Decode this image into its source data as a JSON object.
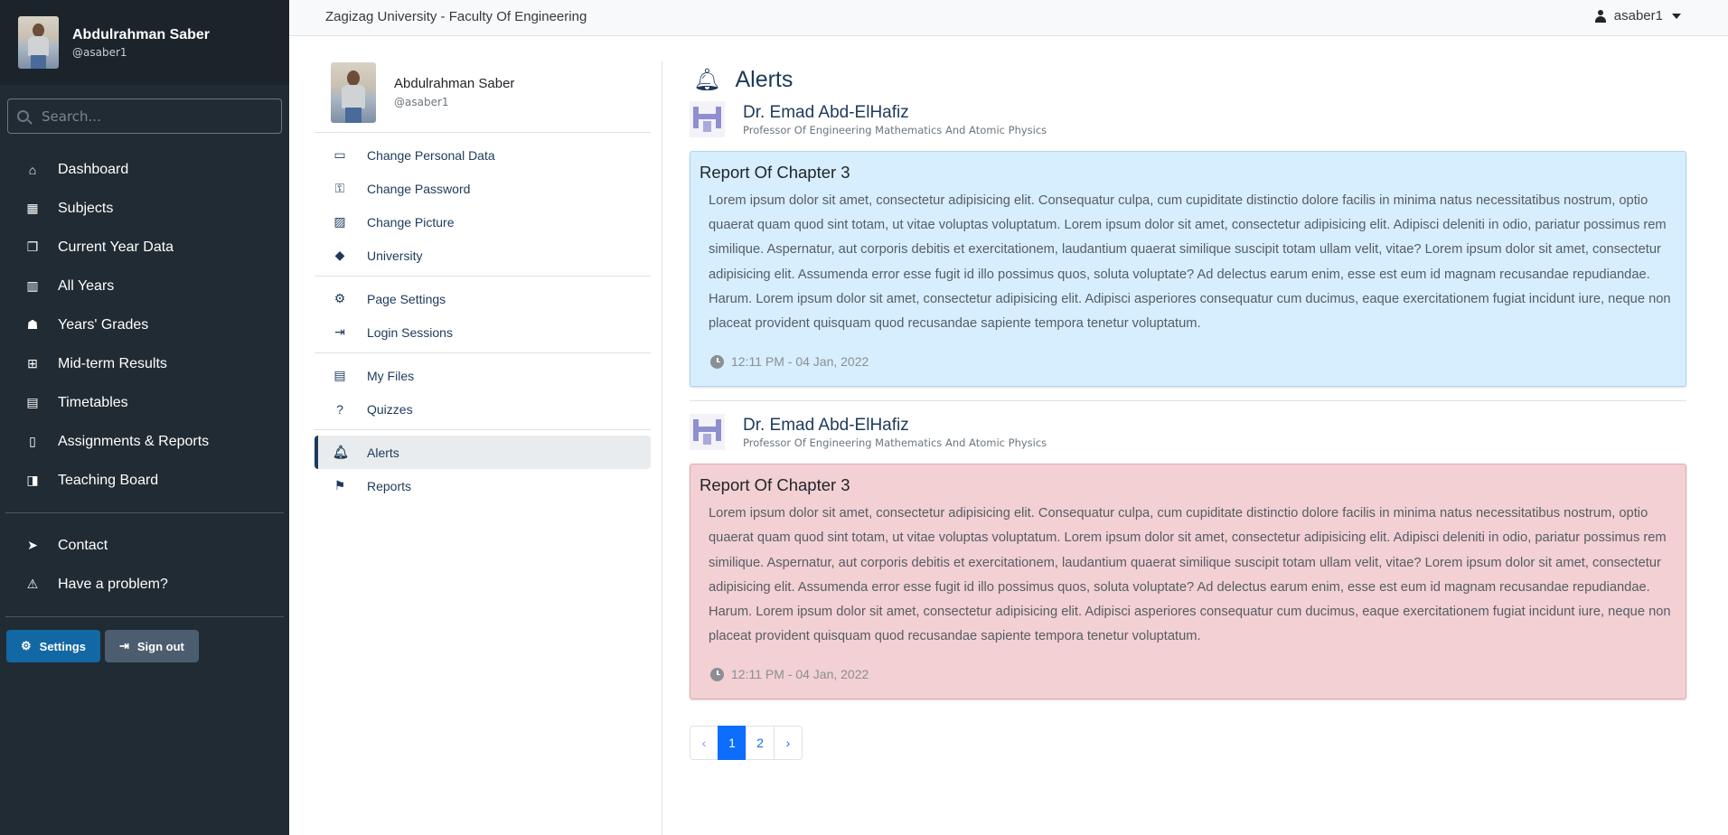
{
  "sidebar": {
    "user": {
      "name": "Abdulrahman Saber",
      "handle": "@asaber1"
    },
    "search_placeholder": "Search...",
    "items": [
      {
        "label": "Dashboard",
        "icon": "home-icon"
      },
      {
        "label": "Subjects",
        "icon": "calculator-icon"
      },
      {
        "label": "Current Year Data",
        "icon": "copy-icon"
      },
      {
        "label": "All Years",
        "icon": "building-icon"
      },
      {
        "label": "Years' Grades",
        "icon": "user-graduate-icon"
      },
      {
        "label": "Mid-term Results",
        "icon": "plus-square-icon"
      },
      {
        "label": "Timetables",
        "icon": "table-icon"
      },
      {
        "label": "Assignments & Reports",
        "icon": "file-icon"
      },
      {
        "label": "Teaching Board",
        "icon": "chalkboard-teacher-icon"
      }
    ],
    "secondary": [
      {
        "label": "Contact",
        "icon": "paper-plane-icon"
      },
      {
        "label": "Have a problem?",
        "icon": "warning-icon"
      }
    ],
    "buttons": {
      "settings": "Settings",
      "signout": "Sign out"
    }
  },
  "topbar": {
    "university": "Zagizag University - Faculty Of Engineering",
    "username": "asaber1"
  },
  "settings_menu": {
    "user": {
      "name": "Abdulrahman Saber",
      "handle": "@asaber1"
    },
    "group1": [
      "Change Personal Data",
      "Change Password",
      "Change Picture",
      "University"
    ],
    "group2": [
      "Page Settings",
      "Login Sessions"
    ],
    "group3": [
      "My Files",
      "Quizzes"
    ],
    "group4": [
      "Alerts",
      "Reports"
    ]
  },
  "alerts": {
    "title": "Alerts",
    "items": [
      {
        "sender": "Dr. Emad Abd-ElHafiz",
        "sender_title": "Professor Of Engineering Mathematics And Atomic Physics",
        "heading": "Report Of Chapter 3",
        "body": "Lorem ipsum dolor sit amet, consectetur adipisicing elit. Consequatur culpa, cum cupiditate distinctio dolore facilis in minima natus necessitatibus nostrum, optio quaerat quam quod sint totam, ut vitae voluptas voluptatum. Lorem ipsum dolor sit amet, consectetur adipisicing elit. Adipisci deleniti in odio, pariatur possimus rem similique. Aspernatur, aut corporis debitis et exercitationem, laudantium quaerat similique suscipit totam ullam velit, vitae? Lorem ipsum dolor sit amet, consectetur adipisicing elit. Assumenda error esse fugit id illo possimus quos, soluta voluptate? Ad delectus earum enim, esse est eum id magnam recusandae repudiandae. Harum. Lorem ipsum dolor sit amet, consectetur adipisicing elit. Adipisci asperiores consequatur cum ducimus, eaque exercitationem fugiat incidunt iure, neque non placeat provident quisquam quod recusandae sapiente tempora tenetur voluptatum.",
        "time": "12:11 PM - 04 Jan, 2022",
        "variant_color": "#d6eefd"
      },
      {
        "sender": "Dr. Emad Abd-ElHafiz",
        "sender_title": "Professor Of Engineering Mathematics And Atomic Physics",
        "heading": "Report Of Chapter 3",
        "body": "Lorem ipsum dolor sit amet, consectetur adipisicing elit. Consequatur culpa, cum cupiditate distinctio dolore facilis in minima natus necessitatibus nostrum, optio quaerat quam quod sint totam, ut vitae voluptas voluptatum. Lorem ipsum dolor sit amet, consectetur adipisicing elit. Adipisci deleniti in odio, pariatur possimus rem similique. Aspernatur, aut corporis debitis et exercitationem, laudantium quaerat similique suscipit totam ullam velit, vitae? Lorem ipsum dolor sit amet, consectetur adipisicing elit. Assumenda error esse fugit id illo possimus quos, soluta voluptate? Ad delectus earum enim, esse est eum id magnam recusandae repudiandae. Harum. Lorem ipsum dolor sit amet, consectetur adipisicing elit. Adipisci asperiores consequatur cum ducimus, eaque exercitationem fugiat incidunt iure, neque non placeat provident quisquam quod recusandae sapiente tempora tenetur voluptatum.",
        "time": "12:11 PM - 04 Jan, 2022",
        "variant_color": "#f2d0d3"
      }
    ]
  },
  "pagination": {
    "prev": "‹",
    "pages": [
      "1",
      "2"
    ],
    "next": "›",
    "current": "1"
  },
  "colors": {
    "sidebar_bg": "#212b33",
    "accent": "#1c3a5a",
    "primary": "#0d6efd",
    "settings_button": "#1168a4"
  }
}
